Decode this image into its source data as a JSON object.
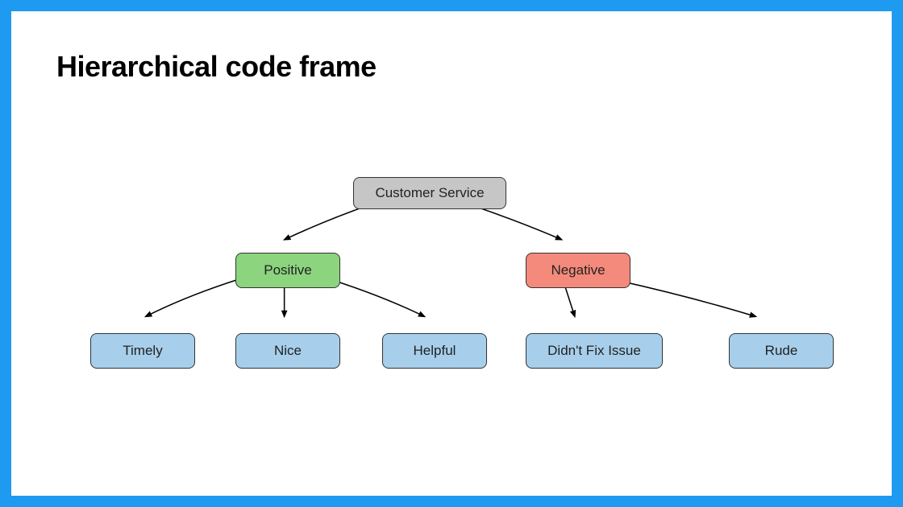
{
  "title": "Hierarchical code frame",
  "colors": {
    "border": "#1E9BF0",
    "root": "#c6c6c6",
    "positive": "#8cd47e",
    "negative": "#f48a7b",
    "leaf": "#a7cfeb"
  },
  "nodes": {
    "root": "Customer Service",
    "positive": "Positive",
    "negative": "Negative",
    "timely": "Timely",
    "nice": "Nice",
    "helpful": "Helpful",
    "didnt_fix": "Didn't Fix Issue",
    "rude": "Rude"
  },
  "diagram": {
    "type": "tree",
    "root": {
      "label_key": "root",
      "children": [
        {
          "label_key": "positive",
          "children": [
            {
              "label_key": "timely"
            },
            {
              "label_key": "nice"
            },
            {
              "label_key": "helpful"
            }
          ]
        },
        {
          "label_key": "negative",
          "children": [
            {
              "label_key": "didnt_fix"
            },
            {
              "label_key": "rude"
            }
          ]
        }
      ]
    }
  }
}
